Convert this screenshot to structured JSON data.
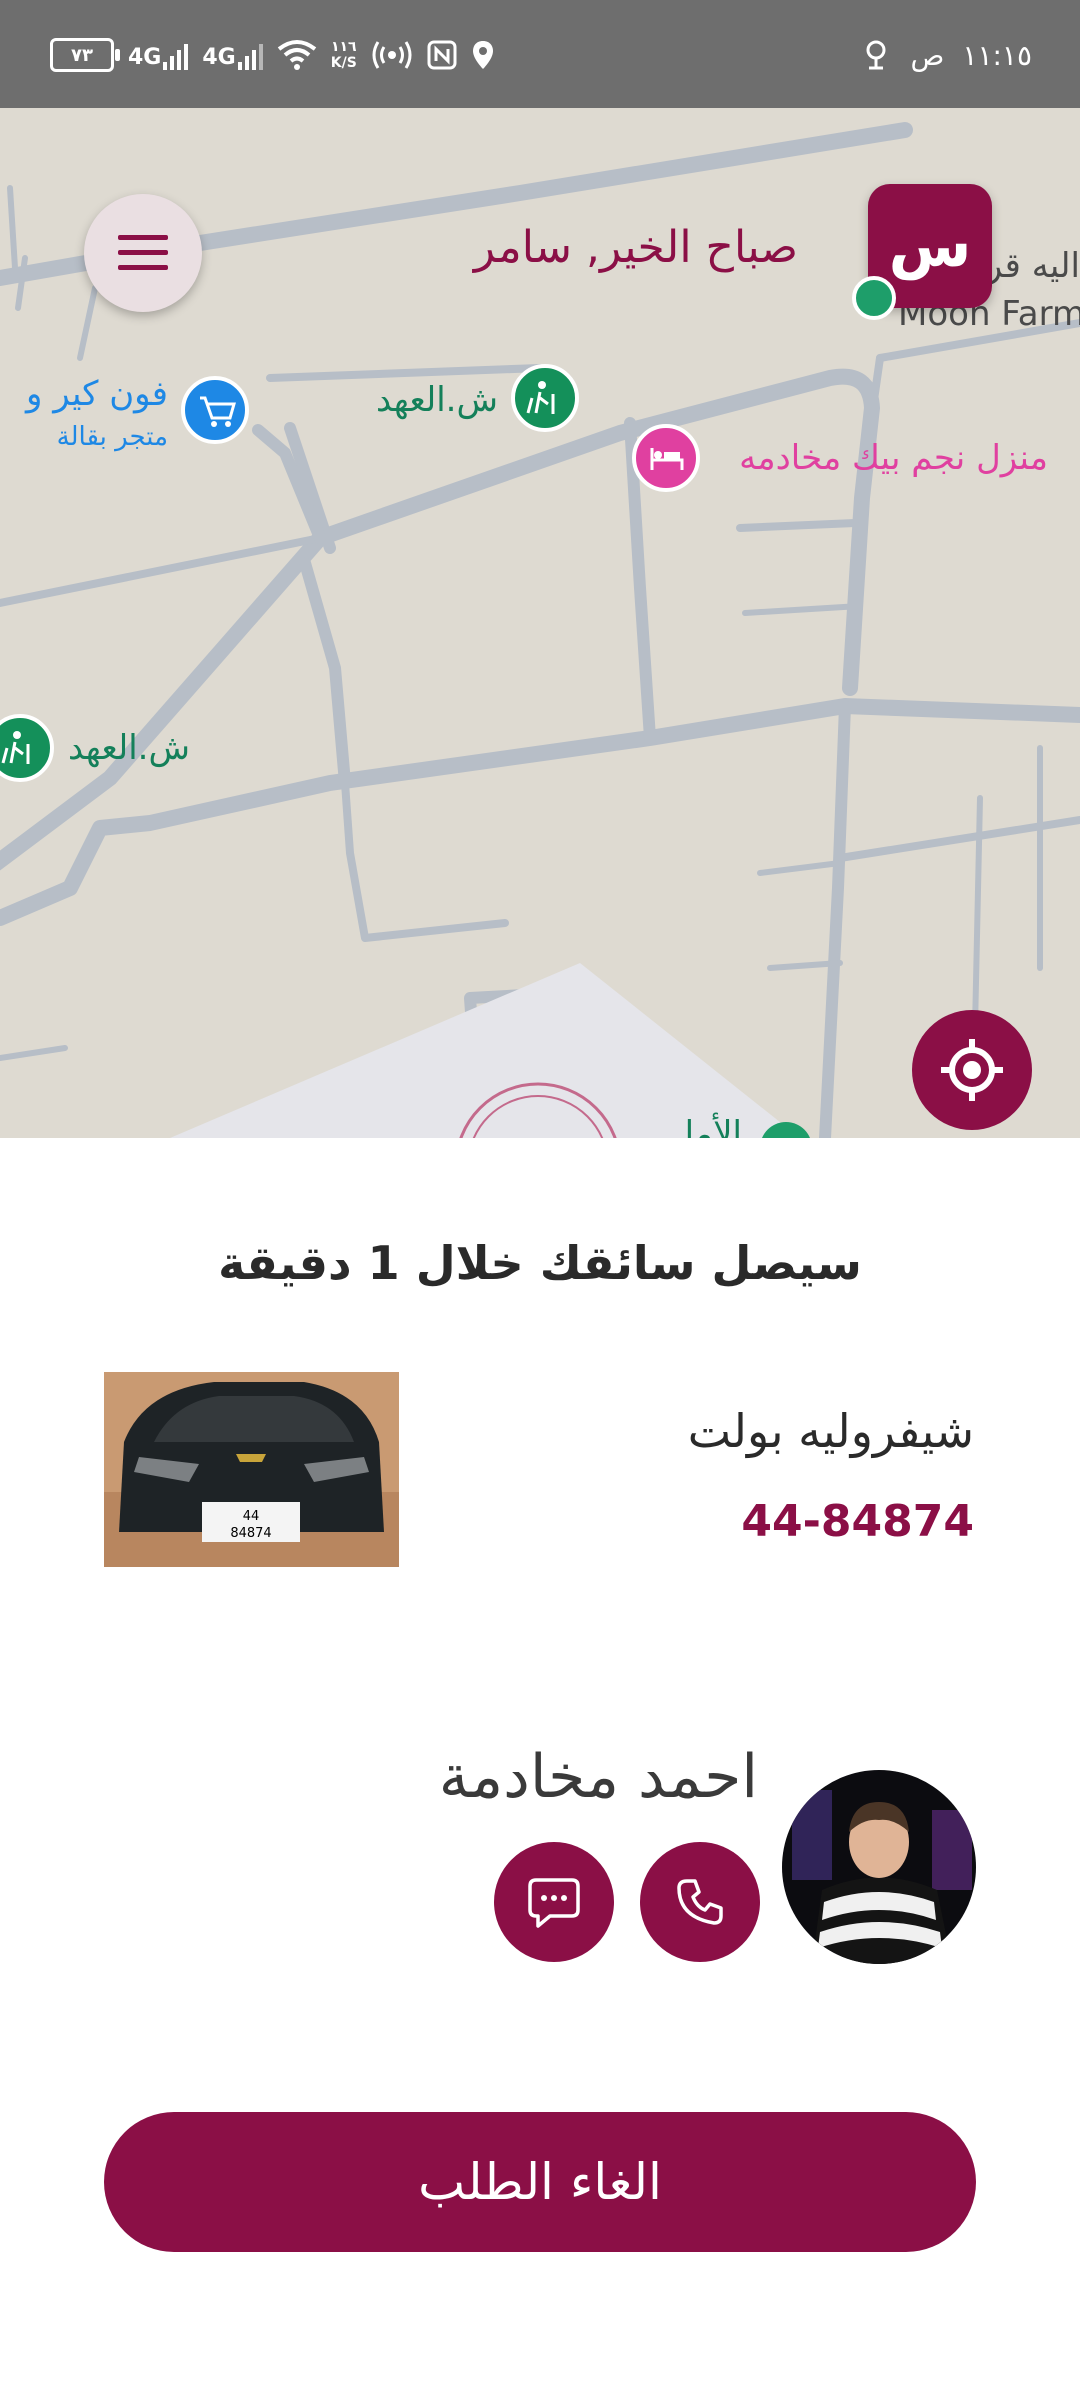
{
  "status_bar": {
    "battery": "٧٣",
    "network1": "4G",
    "network2": "4G",
    "speed_value": "١١٦",
    "speed_unit": "K/S",
    "time": "١١:١٥",
    "ampm": "ص"
  },
  "map": {
    "greeting": "صباح الخير, سامر",
    "avatar_letter": "س",
    "labels": {
      "place_top_right": "اليه قر",
      "farm": "Moon Farm",
      "shop": "فون كير و",
      "shop_sub": "متجر بقالة",
      "street1": "ش.العهد",
      "house": "منزل نجم بيك مخادمه",
      "street2": "ش.العهد",
      "bottom": "الأمل"
    },
    "colors": {
      "brand": "#8b0f46",
      "map_bg": "#dedad1",
      "road": "#b7bec7"
    }
  },
  "ride": {
    "eta_text": "سيصل سائقك خلال 1 دقيقة",
    "car_model": "شيفروليه بولت",
    "car_plate": "44-84874",
    "plate_top": "44",
    "plate_bottom": "84874",
    "driver_name": "احمد مخادمة",
    "cancel_label": "الغاء الطلب"
  },
  "icons": [
    "menu-icon",
    "locate-icon",
    "phone-icon",
    "chat-icon",
    "shopping-cart-icon",
    "hiking-icon",
    "bed-icon",
    "wifi-icon",
    "location-pin-icon",
    "nfc-icon",
    "hotspot-icon"
  ]
}
